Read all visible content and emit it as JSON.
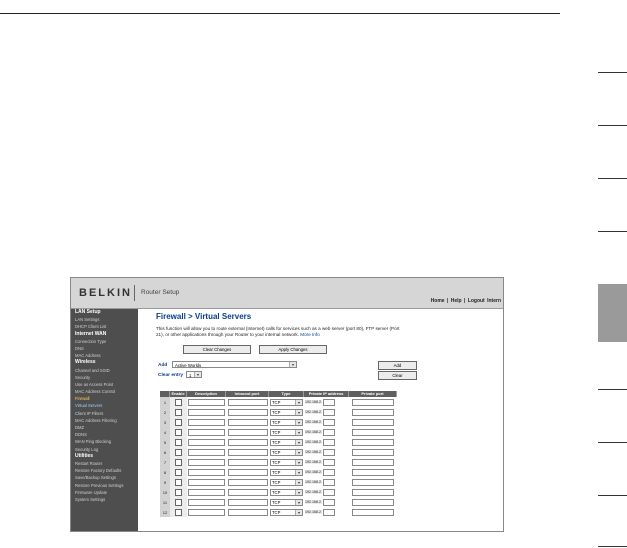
{
  "header": {
    "logo": "BELKIN",
    "title": "Router Setup",
    "links": {
      "home": "Home",
      "sep1": "|",
      "help": "Help",
      "sep2": "|",
      "logout": "Logout",
      "internet": "Intern"
    }
  },
  "sidebar": {
    "items": [
      {
        "label": "LAN Setup",
        "kind": "head"
      },
      {
        "label": "LAN Settings",
        "kind": "item"
      },
      {
        "label": "DHCP Client List",
        "kind": "item"
      },
      {
        "label": "Internet WAN",
        "kind": "head"
      },
      {
        "label": "Connection Type",
        "kind": "item"
      },
      {
        "label": "DNS",
        "kind": "item"
      },
      {
        "label": "MAC Address",
        "kind": "item"
      },
      {
        "label": "Wireless",
        "kind": "head"
      },
      {
        "label": "Channel and SSID",
        "kind": "item"
      },
      {
        "label": "Security",
        "kind": "item"
      },
      {
        "label": "Use as Access Point",
        "kind": "item"
      },
      {
        "label": "MAC Address Control",
        "kind": "item"
      },
      {
        "label": "Firewall",
        "kind": "current"
      },
      {
        "label": "Virtual Servers",
        "kind": "active"
      },
      {
        "label": "Client IP Filters",
        "kind": "item"
      },
      {
        "label": "MAC Address Filtering",
        "kind": "item"
      },
      {
        "label": "DMZ",
        "kind": "item"
      },
      {
        "label": "DDNS",
        "kind": "item"
      },
      {
        "label": "WAN Ping Blocking",
        "kind": "item"
      },
      {
        "label": "Security Log",
        "kind": "item"
      },
      {
        "label": "Utilities",
        "kind": "head"
      },
      {
        "label": "Restart Router",
        "kind": "item"
      },
      {
        "label": "Restore Factory Defaults",
        "kind": "item"
      },
      {
        "label": "Save/Backup Settings",
        "kind": "item"
      },
      {
        "label": "Restore Previous Settings",
        "kind": "item"
      },
      {
        "label": "Firmware Update",
        "kind": "item"
      },
      {
        "label": "System Settings",
        "kind": "item"
      }
    ]
  },
  "main": {
    "title": "Firewall > Virtual Servers",
    "description": "This function will allow you to route external (Internet) calls for services such as a web server (port 80), FTP server (Port 21), or other applications through your Router to your internal network.",
    "more_info": "More Info",
    "clear_changes": "Clear Changes",
    "apply_changes": "Apply Changes",
    "add_label": "Add",
    "add_select_value": "Active Worlds",
    "add_button": "Add",
    "clear_entry_label": "Clear entry",
    "clear_entry_value": "1",
    "clear_button": "Clear",
    "arrow": "▾"
  },
  "table": {
    "headers": [
      "Enable",
      "Description",
      "Inbound port",
      "Type",
      "Private IP address",
      "Private port"
    ],
    "rows": [
      {
        "num": "1",
        "type": "TCP",
        "ip_prefix": "192.168.2."
      },
      {
        "num": "2",
        "type": "TCP",
        "ip_prefix": "192.168.2."
      },
      {
        "num": "3",
        "type": "TCP",
        "ip_prefix": "192.168.2."
      },
      {
        "num": "4",
        "type": "TCP",
        "ip_prefix": "192.168.2."
      },
      {
        "num": "5",
        "type": "TCP",
        "ip_prefix": "192.168.2."
      },
      {
        "num": "6",
        "type": "TCP",
        "ip_prefix": "192.168.2."
      },
      {
        "num": "7",
        "type": "TCP",
        "ip_prefix": "192.168.2."
      },
      {
        "num": "8",
        "type": "TCP",
        "ip_prefix": "192.168.2."
      },
      {
        "num": "9",
        "type": "TCP",
        "ip_prefix": "192.168.2."
      },
      {
        "num": "10",
        "type": "TCP",
        "ip_prefix": "192.168.2."
      },
      {
        "num": "11",
        "type": "TCP",
        "ip_prefix": "192.168.2."
      },
      {
        "num": "12",
        "type": "TCP",
        "ip_prefix": "192.168.2."
      }
    ]
  }
}
